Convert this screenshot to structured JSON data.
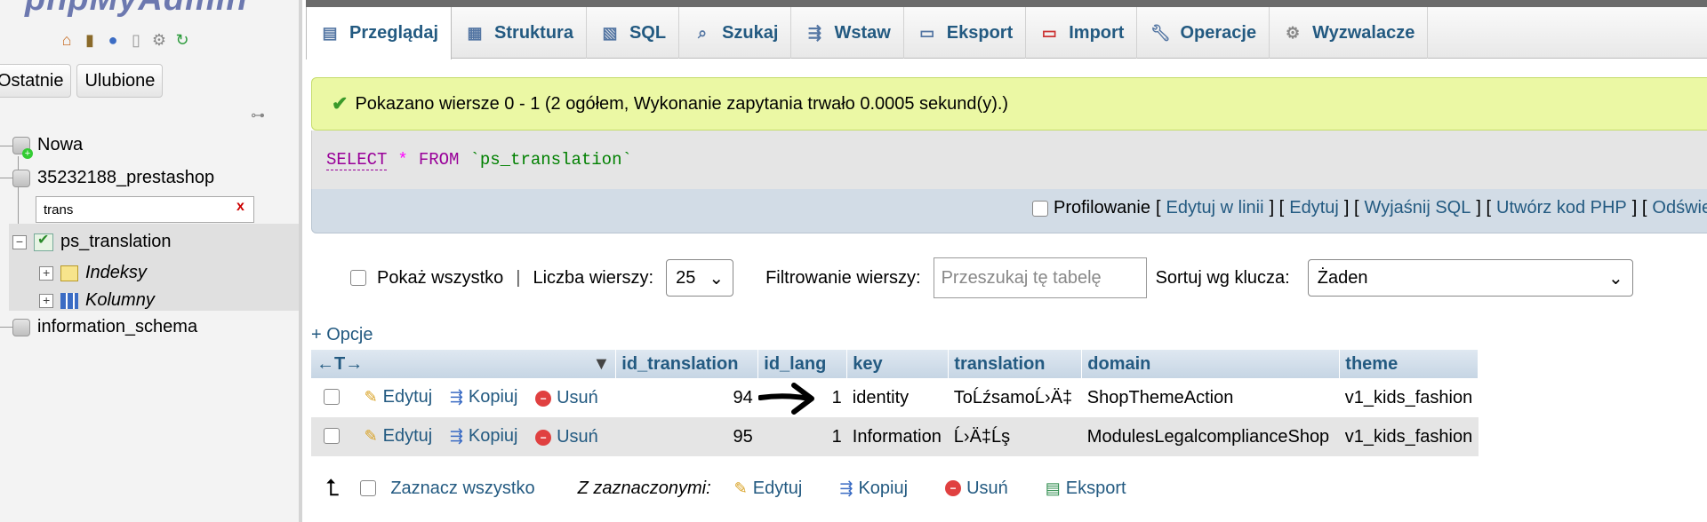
{
  "nav": {
    "logo_main": "phpMyAdmin",
    "recent_tab": "Ostatnie",
    "favorites_tab": "Ulubione",
    "tree": {
      "new": "Nowa",
      "db1": "35232188_prestashop",
      "filter_value": "trans",
      "filter_clear": "x",
      "table": "ps_translation",
      "indexes": "Indeksy",
      "columns": "Kolumny",
      "db2": "information_schema"
    }
  },
  "tabs": [
    {
      "label": "Przeglądaj",
      "icon": "browse-icon",
      "active": true
    },
    {
      "label": "Struktura",
      "icon": "structure-icon"
    },
    {
      "label": "SQL",
      "icon": "sql-icon"
    },
    {
      "label": "Szukaj",
      "icon": "search-icon"
    },
    {
      "label": "Wstaw",
      "icon": "insert-icon"
    },
    {
      "label": "Eksport",
      "icon": "export-icon"
    },
    {
      "label": "Import",
      "icon": "import-icon"
    },
    {
      "label": "Operacje",
      "icon": "wrench-icon"
    },
    {
      "label": "Wyzwalacze",
      "icon": "triggers-icon"
    }
  ],
  "success_message": "Pokazano wiersze 0 - 1 (2 ogółem, Wykonanie zapytania trwało 0.0005 sekund(y).)",
  "sql": {
    "select": "SELECT",
    "star": "*",
    "from": "FROM",
    "table": "`ps_translation`"
  },
  "profiling": {
    "label": "Profilowanie",
    "links": [
      "Edytuj w linii",
      "Edytuj",
      "Wyjaśnij SQL",
      "Utwórz kod PHP",
      "Odśwież"
    ]
  },
  "controls": {
    "show_all": "Pokaż wszystko",
    "separator": "|",
    "rows_label": "Liczba wierszy:",
    "rows_value": "25",
    "filter_label": "Filtrowanie wierszy:",
    "filter_placeholder": "Przeszukaj tę tabelę",
    "sort_label": "Sortuj wg klucza:",
    "sort_value": "Żaden"
  },
  "options_link": "+ Opcje",
  "table": {
    "nav_arrows": "←T→",
    "columns": [
      "id_translation",
      "id_lang",
      "key",
      "translation",
      "domain",
      "theme"
    ],
    "actions": {
      "edit": "Edytuj",
      "copy": "Kopiuj",
      "delete": "Usuń"
    },
    "rows": [
      {
        "id_translation": "94",
        "id_lang": "1",
        "key": "identity",
        "translation": "ToĹźsamoĹ›Ä‡",
        "domain": "ShopThemeAction",
        "theme": "v1_kids_fashion"
      },
      {
        "id_translation": "95",
        "id_lang": "1",
        "key": "Information",
        "translation": "Ĺ›Ä‡Ĺş",
        "domain": "ModulesLegalcomplianceShop",
        "theme": "v1_kids_fashion"
      }
    ]
  },
  "bulk": {
    "select_all": "Zaznacz wszystko",
    "with_selected": "Z zaznaczonymi:",
    "edit": "Edytuj",
    "copy": "Kopiuj",
    "delete": "Usuń",
    "export": "Eksport"
  },
  "colors": {
    "link": "#235a81",
    "success_bg": "#ebf8a4",
    "header_bg": "#c6d5e4"
  }
}
